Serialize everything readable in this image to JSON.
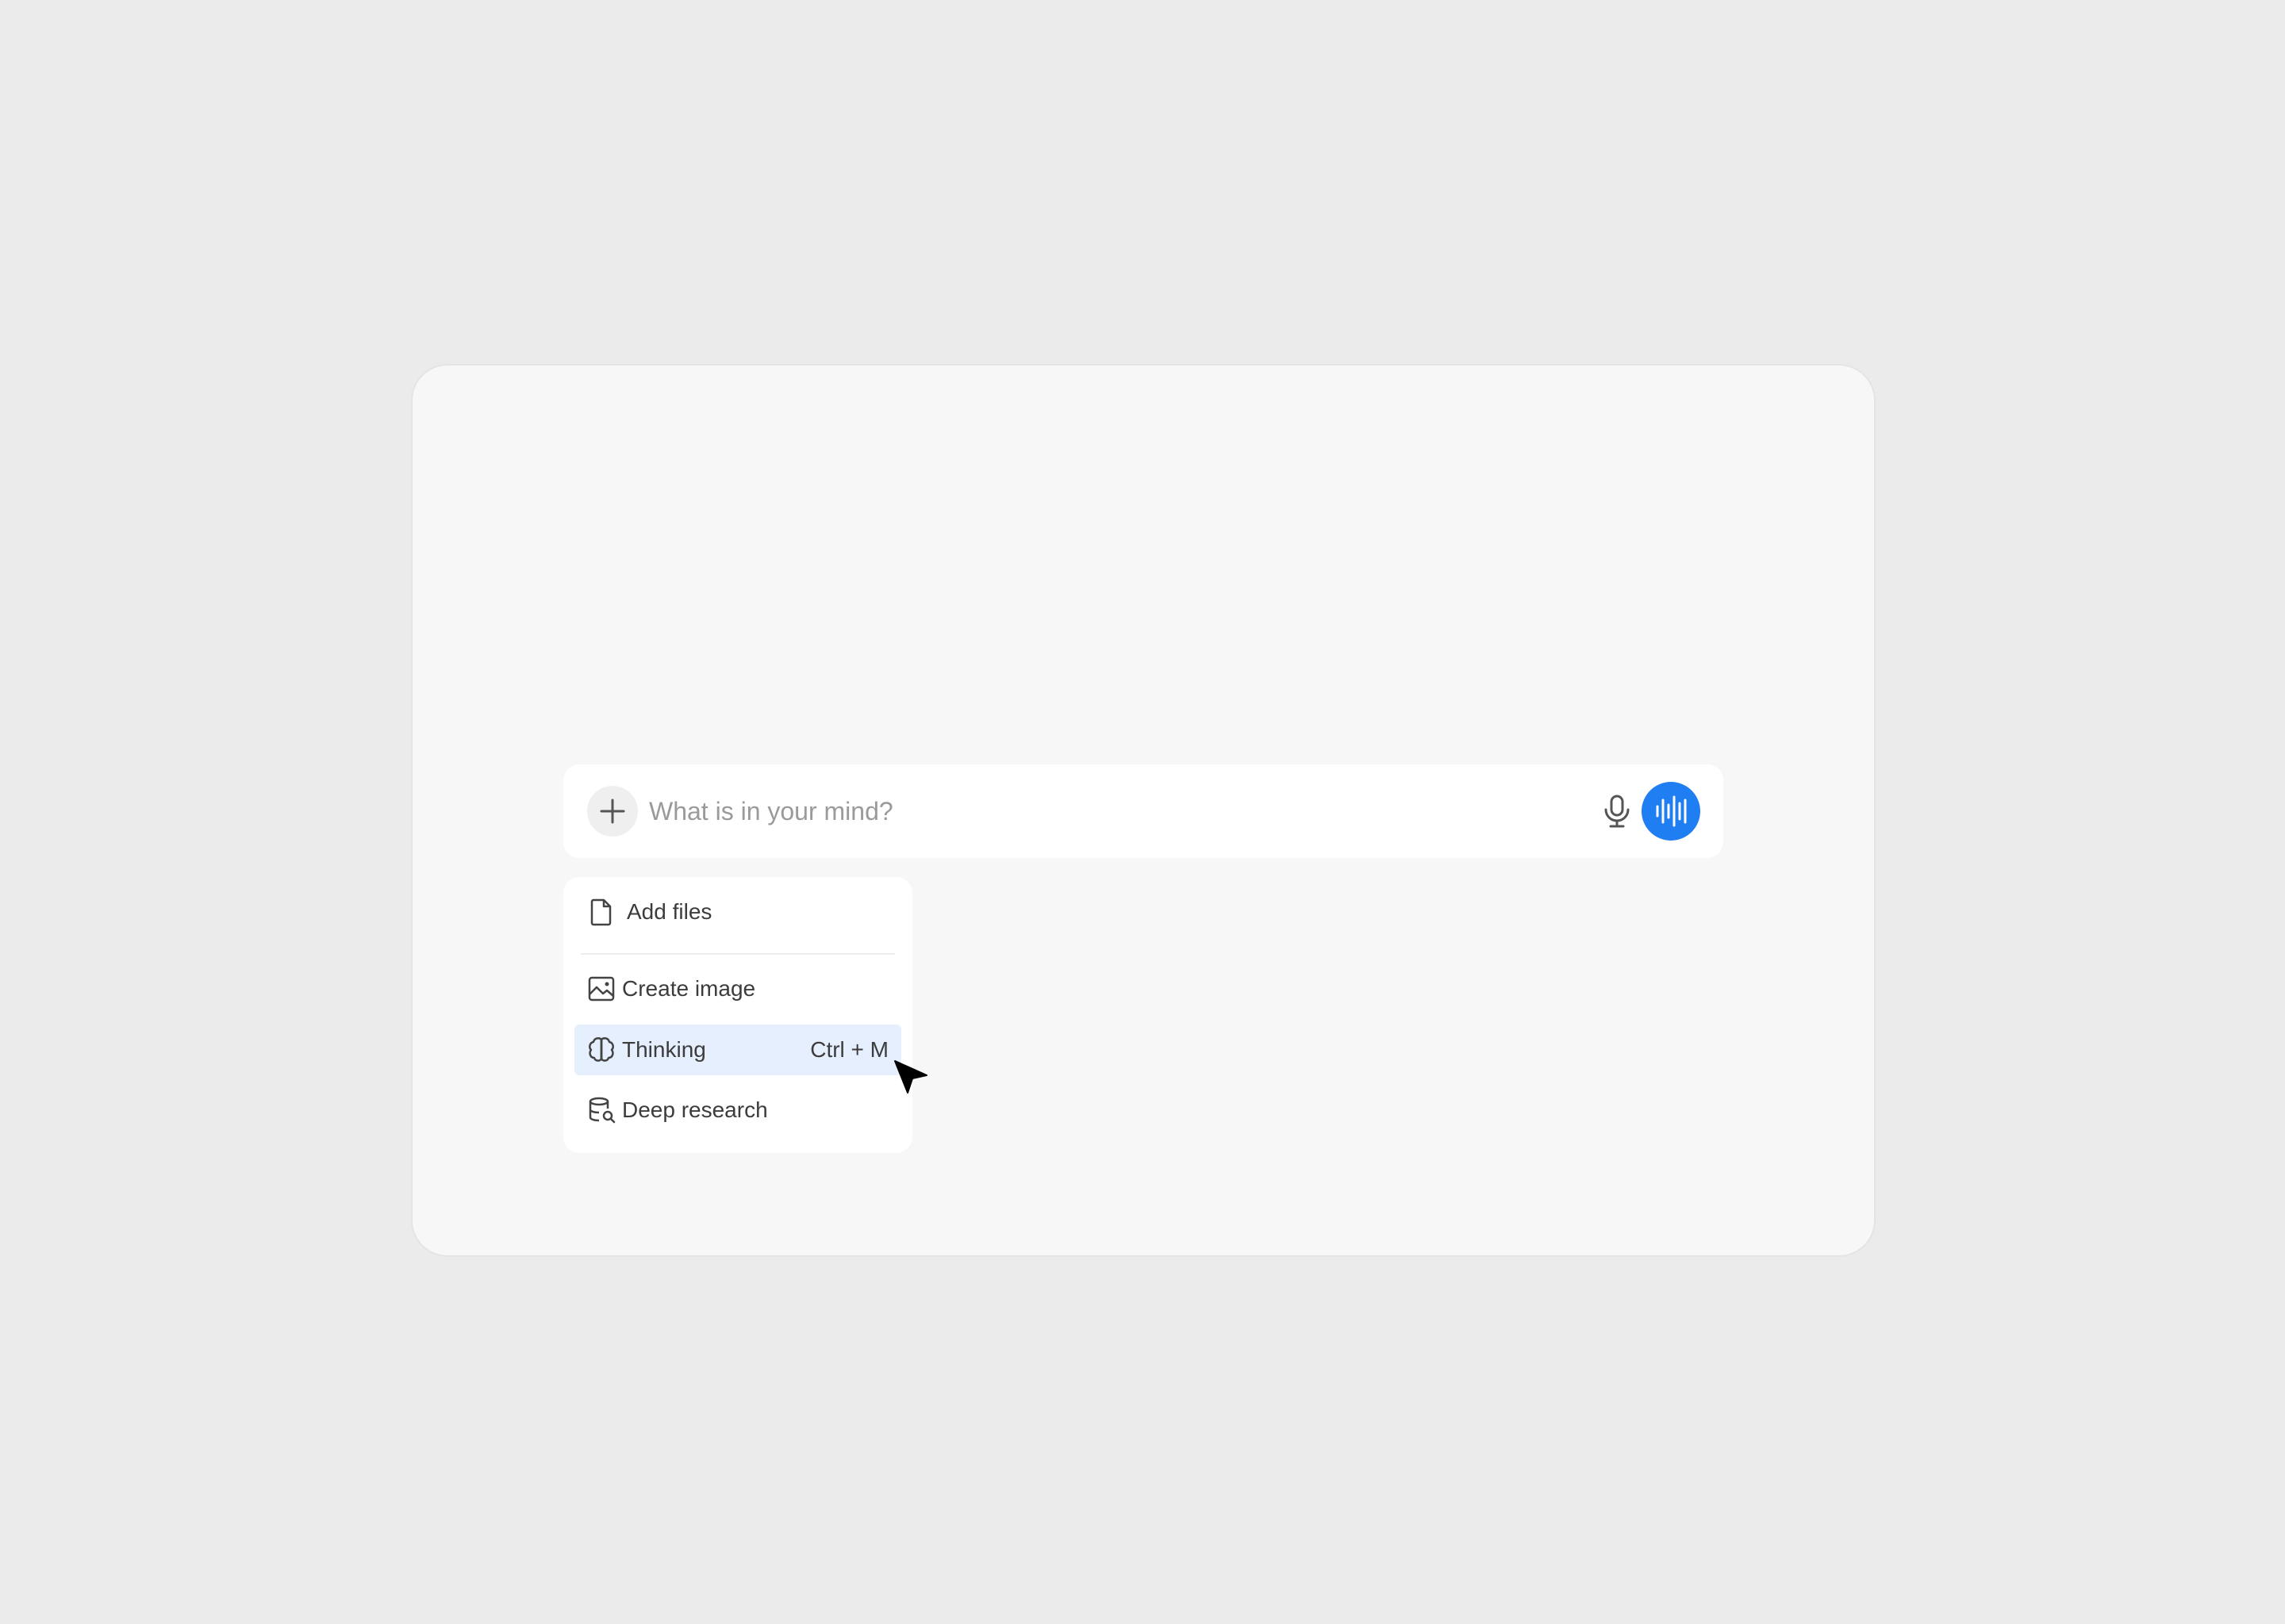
{
  "composer": {
    "placeholder": "What is in your mind?",
    "value": ""
  },
  "menu": {
    "items": [
      {
        "label": "Add files",
        "icon": "file-icon",
        "shortcut": ""
      },
      {
        "label": "Create image",
        "icon": "image-icon",
        "shortcut": ""
      },
      {
        "label": "Thinking",
        "icon": "brain-icon",
        "shortcut": "Ctrl + M",
        "highlighted": true
      },
      {
        "label": "Deep research",
        "icon": "database-search-icon",
        "shortcut": ""
      }
    ]
  },
  "colors": {
    "background": "#ebebeb",
    "panel": "#f7f7f7",
    "accent": "#1f7ef2",
    "highlight": "#e6effd",
    "text": "#3c3c3c",
    "placeholder": "#9a9a9a"
  },
  "icons": {
    "add": "plus-icon",
    "microphone": "microphone-icon",
    "voice_mode": "voice-waveform-icon",
    "pointer": "cursor-icon"
  }
}
